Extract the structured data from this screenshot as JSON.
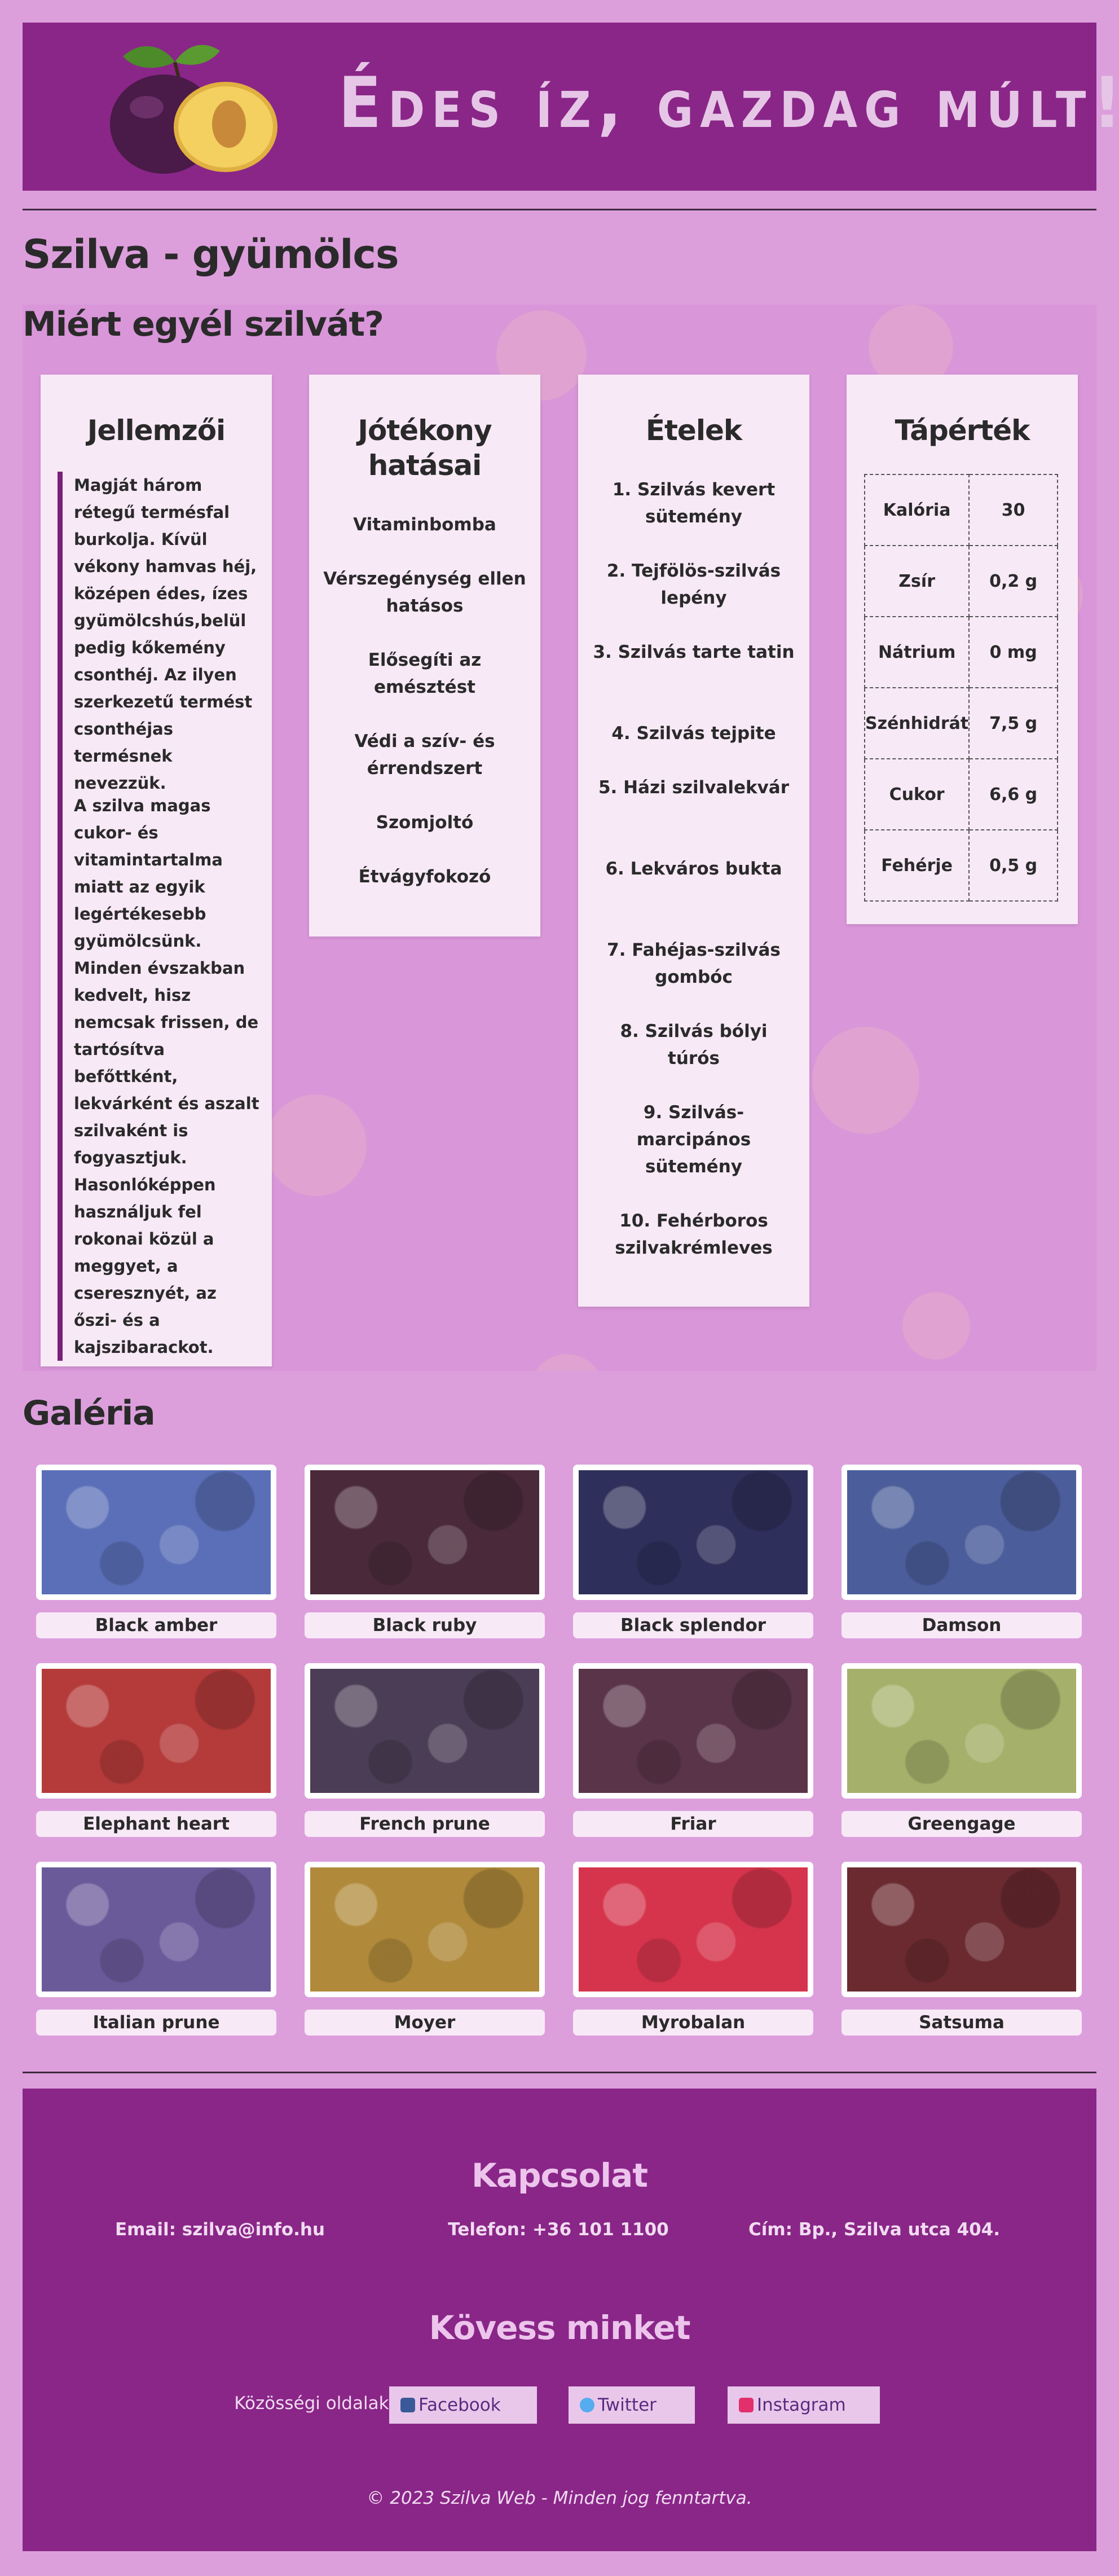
{
  "header": {
    "title": "Édes íz, gazdag múlt!",
    "logo_icon": "plum-logo-icon"
  },
  "page_title": "Szilva - gyümölcs",
  "why": {
    "title": "Miért egyél szilvát?",
    "features": {
      "title": "Jellemzői",
      "paragraphs": [
        "Magját három rétegű termésfal burkolja. Kívül vékony hamvas héj, középen édes, ízes gyümölcshús,belül pedig kőkemény csonthéj. Az ilyen szerkezetű termést csonthéjas termésnek nevezzük.",
        "A szilva magas cukor- és vitamintartalma miatt az egyik legértékesebb gyümölcsünk. Minden évszakban kedvelt, hisz nemcsak frissen, de tartósítva befőttként, lekvárként és aszalt szilvaként is fogyasztjuk. Hasonlóképpen használjuk fel rokonai közül a meggyet, a cseresznyét, az őszi- és a kajszibarackot."
      ]
    },
    "benefits": {
      "title": "Jótékony hatásai",
      "items": [
        "Vitaminbomba",
        "Vérszegénység ellen hatásos",
        "Elősegíti az emésztést",
        "Védi a szív- és érrendszert",
        "Szomjoltó",
        "Étvágyfokozó"
      ]
    },
    "foods": {
      "title": "Ételek",
      "items": [
        "1. Szilvás kevert sütemény",
        "2. Tejfölös-szilvás lepény",
        "3. Szilvás tarte tatin",
        "4. Szilvás tejpite",
        "5. Házi szilvalekvár",
        "6. Lekváros bukta",
        "7. Fahéjas-szilvás gombóc",
        "8. Szilvás bólyi túrós",
        "9. Szilvás-marcipános sütemény",
        "10. Fehérboros szilvakrémleves"
      ]
    },
    "nutrition": {
      "title": "Tápérték",
      "rows": [
        {
          "name": "Kalória",
          "value": "30"
        },
        {
          "name": "Zsír",
          "value": "0,2 g"
        },
        {
          "name": "Nátrium",
          "value": "0 mg"
        },
        {
          "name": "Szénhidrát",
          "value": "7,5 g"
        },
        {
          "name": "Cukor",
          "value": "6,6 g"
        },
        {
          "name": "Fehérje",
          "value": "0,5 g"
        }
      ]
    }
  },
  "gallery": {
    "title": "Galéria",
    "items": [
      {
        "caption": "Black amber",
        "color": "#5a6fb8"
      },
      {
        "caption": "Black ruby",
        "color": "#4a2a3a"
      },
      {
        "caption": "Black splendor",
        "color": "#2e2f5a"
      },
      {
        "caption": "Damson",
        "color": "#4b5d9a"
      },
      {
        "caption": "Elephant heart",
        "color": "#b53a3a"
      },
      {
        "caption": "French prune",
        "color": "#4b3d55"
      },
      {
        "caption": "Friar",
        "color": "#5a3448"
      },
      {
        "caption": "Greengage",
        "color": "#a5b06a"
      },
      {
        "caption": "Italian prune",
        "color": "#6b5a9a"
      },
      {
        "caption": "Moyer",
        "color": "#b08a3a"
      },
      {
        "caption": "Myrobalan",
        "color": "#d6344c"
      },
      {
        "caption": "Satsuma",
        "color": "#6a2a30"
      }
    ]
  },
  "footer": {
    "contact_title": "Kapcsolat",
    "email": "Email: szilva@info.hu",
    "phone": "Telefon: +36 101 1100",
    "address": "Cím: Bp., Szilva utca 404.",
    "follow_title": "Kövess minket",
    "social_label": "Közösségi oldalak:",
    "social": [
      {
        "label": "Facebook",
        "icon": "facebook-icon"
      },
      {
        "label": "Twitter",
        "icon": "twitter-icon"
      },
      {
        "label": "Instagram",
        "icon": "instagram-icon"
      }
    ],
    "copyright": "© 2023 Szilva Web - Minden jog fenntartva."
  }
}
